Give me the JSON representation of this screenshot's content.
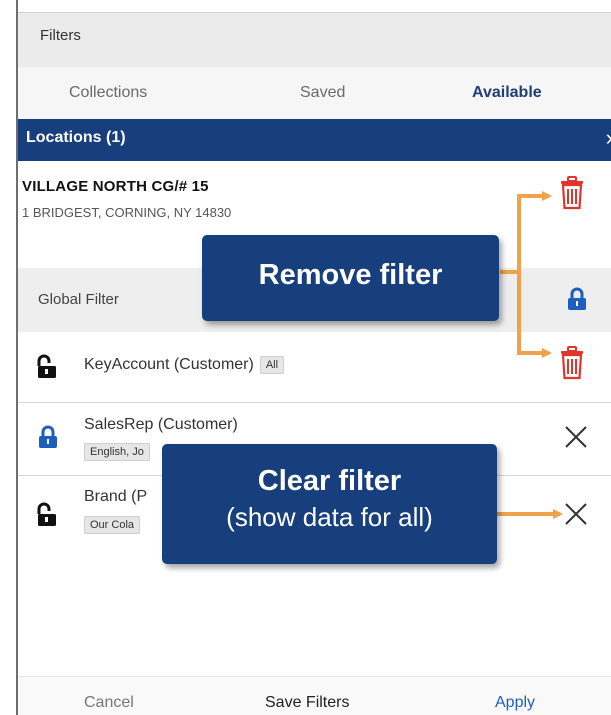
{
  "header": {
    "title": "Filters"
  },
  "tabs": [
    {
      "label": "Collections",
      "active": false
    },
    {
      "label": "Saved",
      "active": false
    },
    {
      "label": "Available",
      "active": true
    }
  ],
  "locations": {
    "bar_label": "Locations (1)",
    "item": {
      "name": "VILLAGE NORTH CG/# 15",
      "address": "1 BRIDGEST, CORNING, NY 14830"
    }
  },
  "global_filter": {
    "title": "Global Filter",
    "rows": [
      {
        "label": "KeyAccount (Customer)",
        "value": "All",
        "lock": "unlocked",
        "action": "delete"
      },
      {
        "label": "SalesRep (Customer)",
        "value": "English, Jo",
        "lock": "locked",
        "action": "clear"
      },
      {
        "label": "Brand (P",
        "value": "Our Cola",
        "lock": "unlocked",
        "action": "clear"
      }
    ]
  },
  "footer": {
    "cancel": "Cancel",
    "save": "Save Filters",
    "apply": "Apply"
  },
  "callouts": {
    "remove": "Remove filter",
    "clear_line1": "Clear filter",
    "clear_line2": "(show data for all)"
  },
  "colors": {
    "brand_navy": "#173f7e",
    "delete_red": "#e0352b",
    "lock_blue": "#1d5fbf",
    "arrow_orange": "#f0a24a"
  }
}
